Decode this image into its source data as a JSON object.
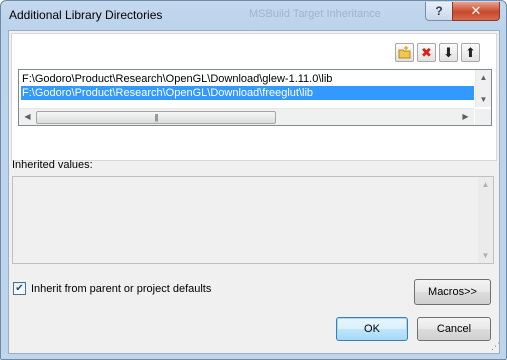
{
  "window": {
    "title": "Additional Library Directories",
    "background_title": "MSBuild Target Inheritance",
    "help_label": "?",
    "close_label": "✕"
  },
  "toolbar": {
    "new_line_icon": "new-folder-icon",
    "delete_icon": "delete-icon",
    "move_down_icon": "arrow-down-icon",
    "move_up_icon": "arrow-up-icon",
    "delete_glyph": "✖",
    "down_glyph": "⬇",
    "up_glyph": "⬆"
  },
  "directories": {
    "items": [
      "F:\\Godoro\\Product\\Research\\OpenGL\\Download\\glew-1.11.0\\lib",
      "F:\\Godoro\\Product\\Research\\OpenGL\\Download\\freeglut\\lib"
    ],
    "selected_index": 1
  },
  "scroll": {
    "up_arrow": "▲",
    "down_arrow": "▼",
    "left_arrow": "◀",
    "right_arrow": "▶",
    "grip": "|||"
  },
  "inherited": {
    "label": "Inherited values:",
    "values": []
  },
  "inherit_checkbox": {
    "label": "Inherit from parent or project defaults",
    "checked": true,
    "check_glyph": "✔"
  },
  "buttons": {
    "macros_label": "Macros>>",
    "ok_label": "OK",
    "cancel_label": "Cancel"
  },
  "colors": {
    "selection": "#3399ff",
    "close_button": "#c74a2c",
    "default_button_border": "#3c7fb1"
  }
}
